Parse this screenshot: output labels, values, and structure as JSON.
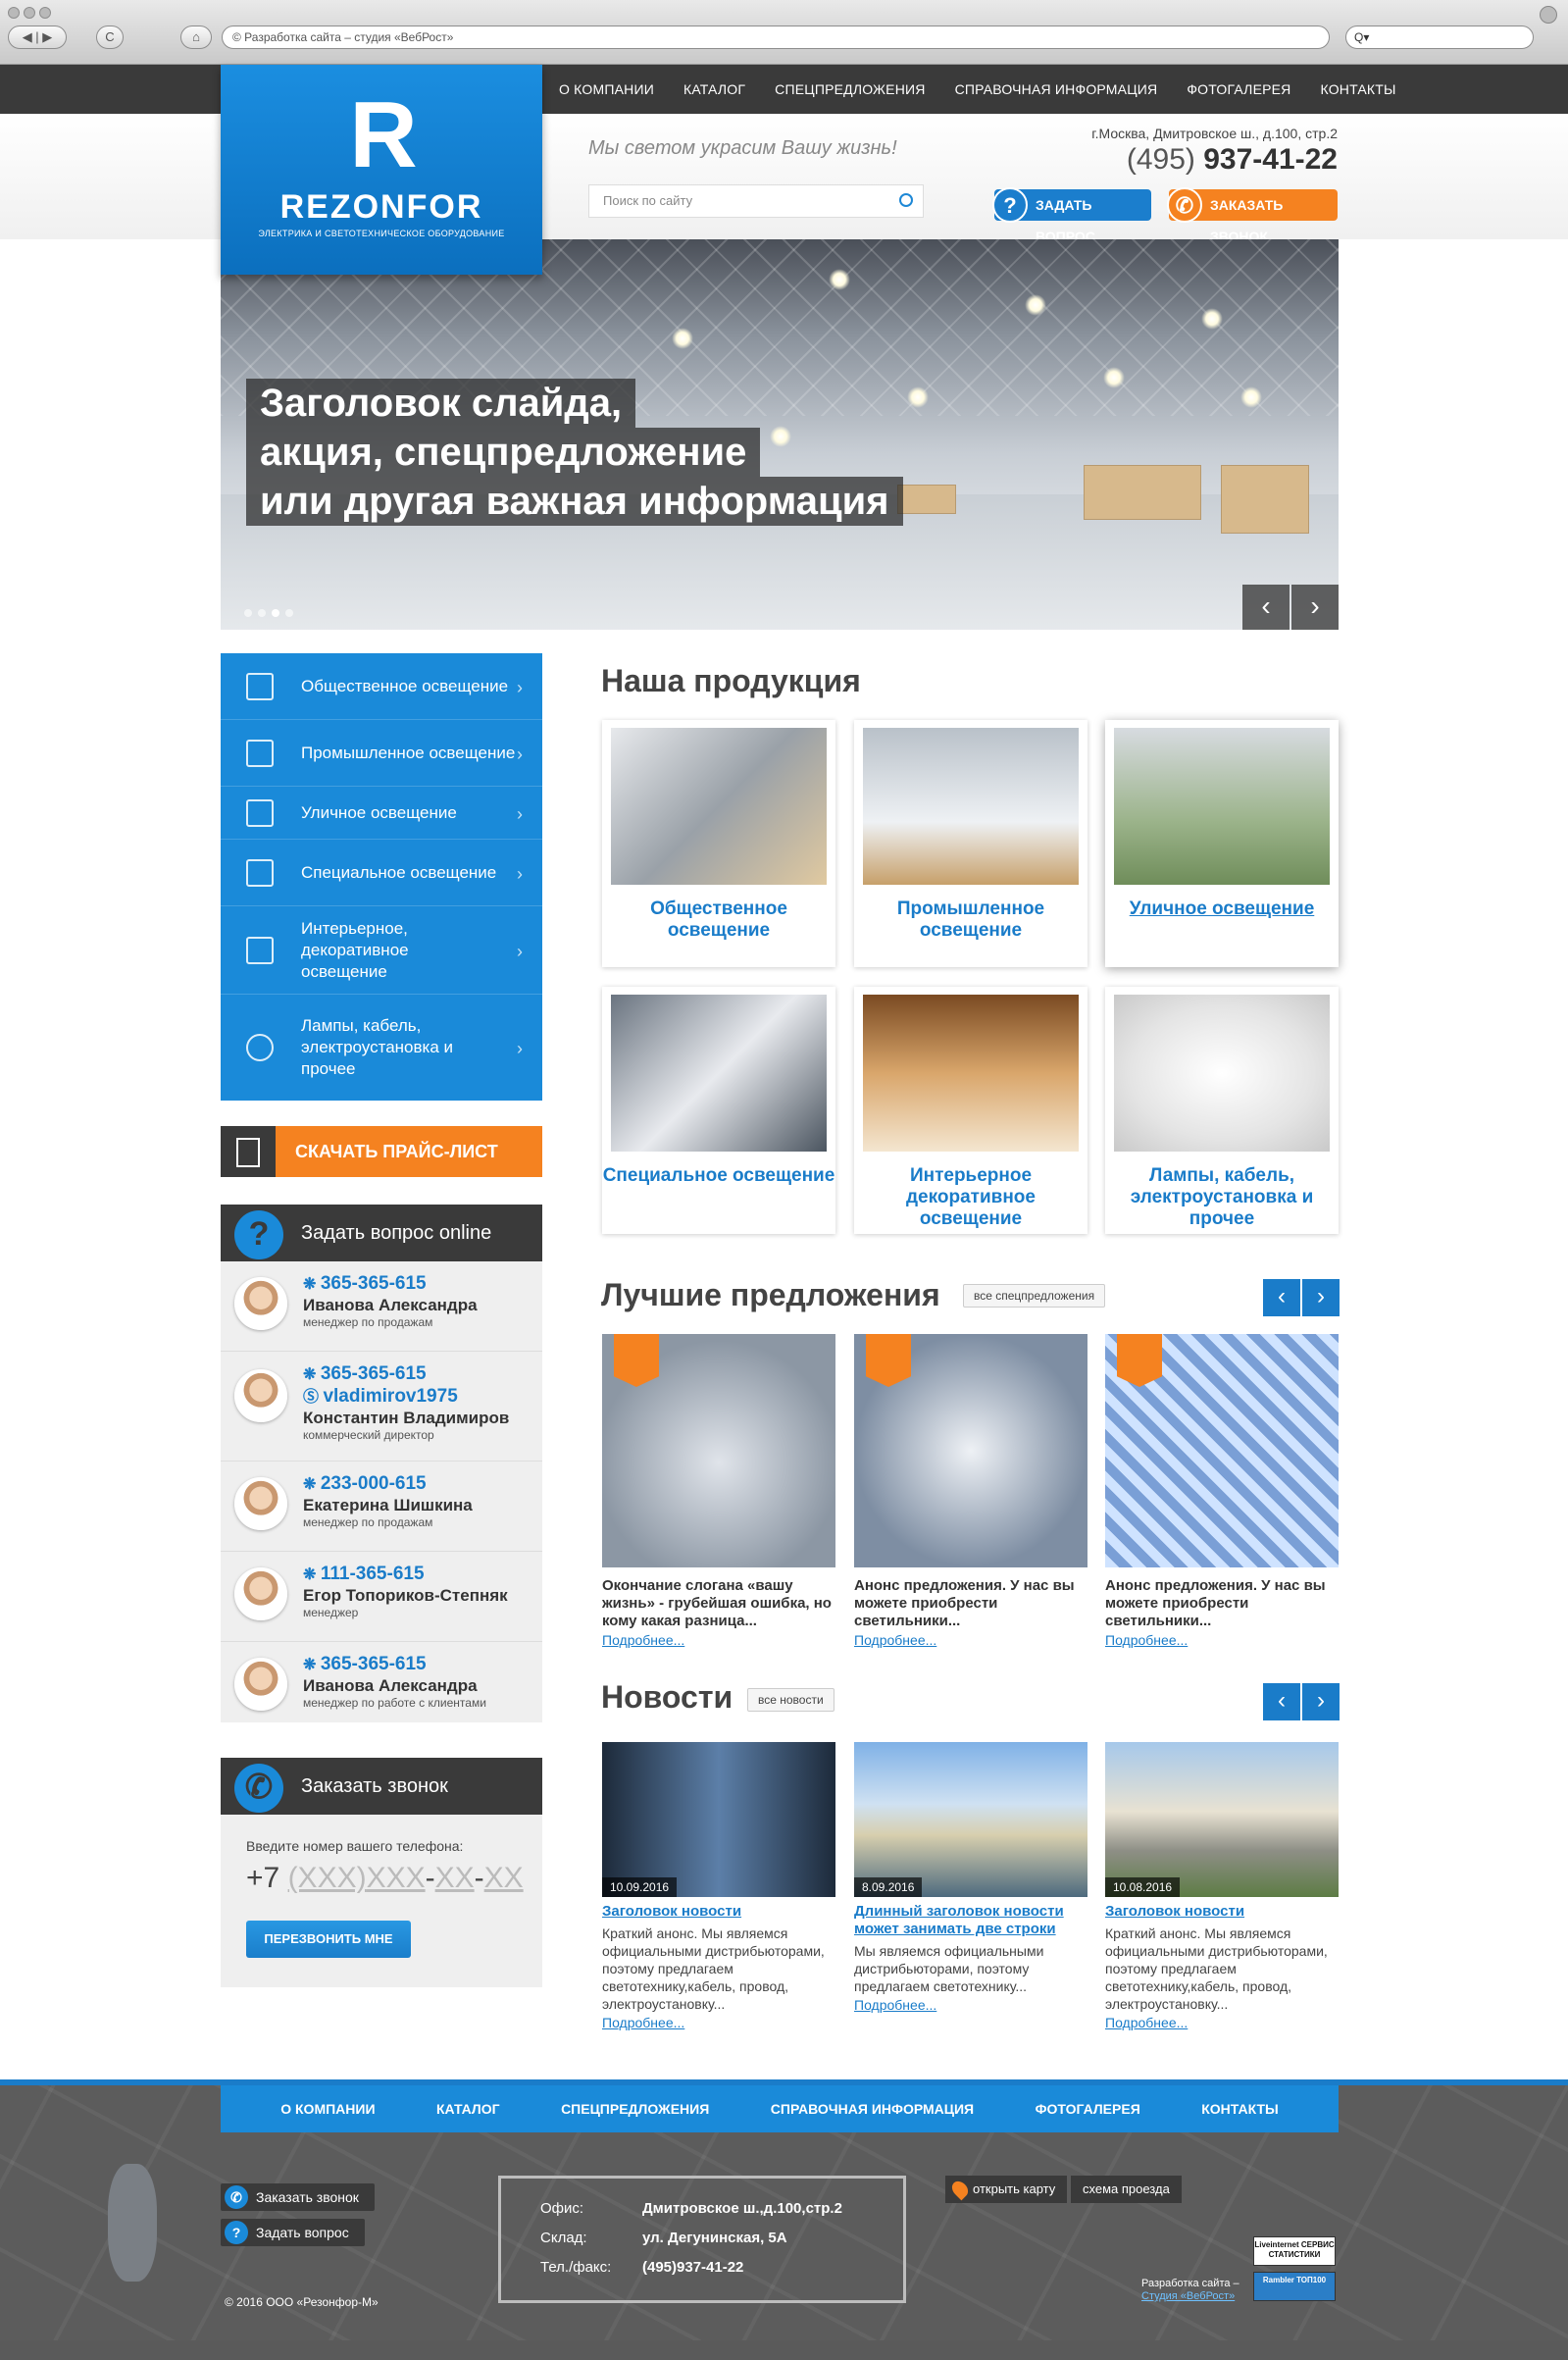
{
  "browser": {
    "url": "© Разработка сайта – студия «ВебРост»",
    "back": "◀",
    "forward": "▶",
    "reload": "C",
    "home": "⌂",
    "search_placeholder": "Q▾"
  },
  "topnav": [
    "О КОМПАНИИ",
    "КАТАЛОГ",
    "СПЕЦПРЕДЛОЖЕНИЯ",
    "СПРАВОЧНАЯ ИНФОРМАЦИЯ",
    "ФОТОГАЛЕРЕЯ",
    "КОНТАКТЫ"
  ],
  "logo": {
    "letter": "R",
    "name": "REZONFOR",
    "tagline": "ЭЛЕКТРИКА И СВЕТОТЕХНИЧЕСКОЕ ОБОРУДОВАНИЕ"
  },
  "header": {
    "slogan": "Мы светом украсим Вашу жизнь!",
    "search_placeholder": "Поиск по сайту",
    "address": "г.Москва, Дмитровское ш., д.100, стр.2",
    "phone_code": "(495)",
    "phone_number": "937-41-22",
    "ask_button": "ЗАДАТЬ ВОПРОС",
    "call_button": "ЗАКАЗАТЬ ЗВОНОК",
    "ask_icon": "?",
    "call_icon": "✆"
  },
  "slider": {
    "lines": [
      "Заголовок слайда,",
      "акция, спецпредложение",
      "или другая важная информация"
    ],
    "prev": "‹",
    "next": "›"
  },
  "sidebar": {
    "items": [
      {
        "label": "Общественное освещение",
        "icon": "building-icon"
      },
      {
        "label": "Промышленное освещение",
        "icon": "factory-icon"
      },
      {
        "label": "Уличное освещение",
        "icon": "street-icon"
      },
      {
        "label": "Специальное освещение",
        "icon": "case-icon"
      },
      {
        "label": "Интерьерное, декоративное освещение",
        "icon": "interior-icon"
      },
      {
        "label": "Лампы, кабель, электроустановка и прочее",
        "icon": "bulb-icon"
      }
    ],
    "arrow": "›"
  },
  "price_button": "СКАЧАТЬ ПРАЙС-ЛИСТ",
  "ask_online": {
    "title": "Задать вопрос online",
    "icon": "?",
    "contacts": [
      {
        "phone": "365-365-615",
        "skype": "",
        "name": "Иванова Александра",
        "role": "менеджер по продажам"
      },
      {
        "phone": "365-365-615",
        "skype": "vladimirov1975",
        "name": "Константин Владимиров",
        "role": "коммерческий директор"
      },
      {
        "phone": "233-000-615",
        "skype": "",
        "name": "Екатерина Шишкина",
        "role": "менеджер по продажам"
      },
      {
        "phone": "111-365-615",
        "skype": "",
        "name": "Егор Топориков-Степняк",
        "role": "менеджер"
      },
      {
        "phone": "365-365-615",
        "skype": "",
        "name": "Иванова Александра",
        "role": "менеджер по работе с клиентами"
      }
    ]
  },
  "callback": {
    "title": "Заказать звонок",
    "icon": "✆",
    "label": "Введите номер вашего телефона:",
    "prefix": "+7",
    "mask_code": "(XXX)",
    "mask_a": "XXX",
    "mask_b": "XX",
    "mask_c": "XX",
    "button": "ПЕРЕЗВОНИТЬ МНЕ"
  },
  "products": {
    "title": "Наша продукция",
    "items": [
      "Общественное освещение",
      "Промышленное освещение",
      "Уличное освещение",
      "Специальное освещение",
      "Интерьерное декоративное освещение",
      "Лампы, кабель, электроустановка и прочее"
    ]
  },
  "offers": {
    "title": "Лучшие предложения",
    "all_link": "все спецпредложения",
    "prev": "‹",
    "next": "›",
    "items": [
      {
        "text": "Окончание слогана «вашу жизнь» - грубейшая ошибка, но кому какая разница...",
        "more": "Подробнее..."
      },
      {
        "text": "Анонс предложения. У нас вы можете приобрести светильники...",
        "more": "Подробнее..."
      },
      {
        "text": "Анонс предложения. У нас вы можете приобрести светильники...",
        "more": "Подробнее..."
      }
    ]
  },
  "news": {
    "title": "Новости",
    "all_link": "все новости",
    "prev": "‹",
    "next": "›",
    "items": [
      {
        "date": "10.09.2016",
        "title": "Заголовок новости",
        "text": "Краткий анонс. Мы являемся официальными дистрибьюторами, поэтому предлагаем светотехнику,кабель, провод, электроустановку...",
        "more": "Подробнее..."
      },
      {
        "date": "8.09.2016",
        "title": "Длинный заголовок новости может занимать две строки",
        "text": "Мы являемся официальными дистрибьюторами, поэтому предлагаем светотехнику...",
        "more": "Подробнее..."
      },
      {
        "date": "10.08.2016",
        "title": "Заголовок новости",
        "text": "Краткий анонс. Мы являемся официальными дистрибьюторами, поэтому предлагаем светотехнику,кабель, провод, электроустановку...",
        "more": "Подробнее..."
      }
    ]
  },
  "footer": {
    "nav": [
      "О КОМПАНИИ",
      "КАТАЛОГ",
      "СПЕЦПРЕДЛОЖЕНИЯ",
      "СПРАВОЧНАЯ ИНФОРМАЦИЯ",
      "ФОТОГАЛЕРЕЯ",
      "КОНТАКТЫ"
    ],
    "call_button": "Заказать звонок",
    "ask_button": "Задать вопрос",
    "office_label": "Офис:",
    "office": "Дмитровское ш.,д.100,стр.2",
    "warehouse_label": "Склад:",
    "warehouse": "ул. Дегунинская, 5А",
    "phone_label": "Тел./факс:",
    "phone": "(495)937-41-22",
    "open_map": "открыть карту",
    "scheme": "схема проезда",
    "copyright": "© 2016 ООО «Резонфор-М»",
    "dev_line1": "Разработка сайта –",
    "dev_line2": "Студия «ВебРост»",
    "counter1": "Liveinternet СЕРВИС СТАТИСТИКИ",
    "counter2": "Rambler ТОП100"
  }
}
